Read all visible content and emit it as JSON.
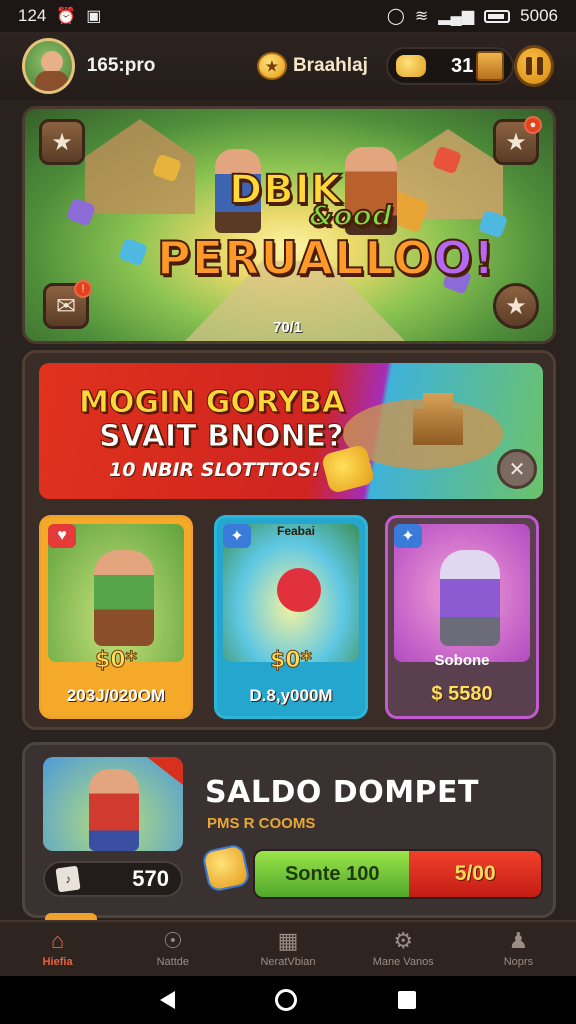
{
  "status_bar": {
    "time": "124",
    "right_text": "5006"
  },
  "header": {
    "username": "165:pro",
    "currency1_label": "Braahlaj",
    "currency2_value": "31"
  },
  "hero": {
    "title_line1": "DBIK",
    "title_line2": "&ood",
    "title_line3_main": "PERUALLO",
    "title_line3_accent": "O!",
    "counter": "70/1"
  },
  "promo": {
    "line1": "MOGIN GORYBA",
    "line2": "SVAIT BNONE?",
    "line3": "10 NBIR SLOTTTOS!"
  },
  "offer_cards": [
    {
      "price": "$0*",
      "value": "203J/020OM"
    },
    {
      "tag": "Feabai",
      "price": "$0*",
      "value": "D.8,y000M"
    },
    {
      "subtitle": "Sobone",
      "value": "$ 5580"
    }
  ],
  "wallet": {
    "title": "SALDO DOMPET",
    "subtitle": "PMS R COOMS",
    "balance": "570",
    "green_label": "Sonte 100",
    "red_label": "5/00"
  },
  "bottom_nav": [
    {
      "label": "Hiefia",
      "icon": "home-icon",
      "active": true
    },
    {
      "label": "Nattde",
      "icon": "compass-icon",
      "active": false
    },
    {
      "label": "NeratVbian",
      "icon": "map-icon",
      "active": false
    },
    {
      "label": "Mane Vanos",
      "icon": "gear-icon",
      "active": false
    },
    {
      "label": "Noprs",
      "icon": "profile-icon",
      "active": false
    }
  ],
  "colors": {
    "accent_orange": "#f0603a",
    "gold": "#f4a928",
    "background": "#2a221f"
  }
}
